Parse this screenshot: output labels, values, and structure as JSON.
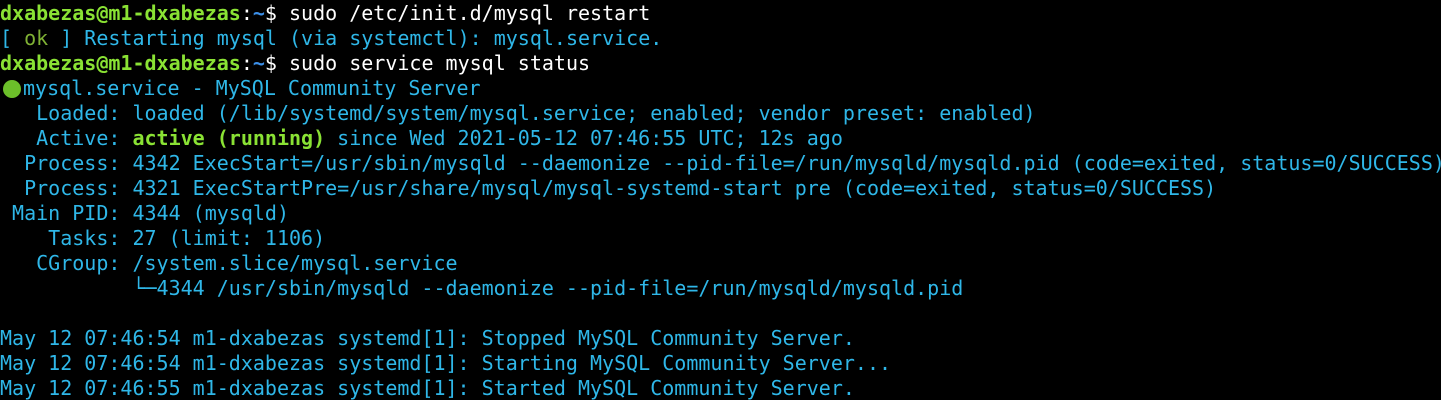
{
  "prompt": {
    "user_host": "dxabezas@m1-dxabezas",
    "separator": ":",
    "path": "~",
    "symbol": "$"
  },
  "commands": [
    "sudo /etc/init.d/mysql restart",
    "sudo service mysql status"
  ],
  "restart_output": {
    "open_bracket": "[ ",
    "ok": "ok",
    "close_bracket": " ] Restarting mysql (via systemctl): mysql.service."
  },
  "status": {
    "unit": "mysql.service - MySQL Community Server",
    "loaded_label": "   Loaded: ",
    "loaded_value": "loaded (/lib/systemd/system/mysql.service; enabled; vendor preset: enabled)",
    "active_label": "   Active: ",
    "active_state": "active (running)",
    "active_since": " since Wed 2021-05-12 07:46:55 UTC; 12s ago",
    "process1": "  Process: 4342 ExecStart=/usr/sbin/mysqld --daemonize --pid-file=/run/mysqld/mysqld.pid (code=exited, status=0/SUCCESS)",
    "process2": "  Process: 4321 ExecStartPre=/usr/share/mysql/mysql-systemd-start pre (code=exited, status=0/SUCCESS)",
    "main_pid": " Main PID: 4344 (mysqld)",
    "tasks": "    Tasks: 27 (limit: 1106)",
    "cgroup": "   CGroup: /system.slice/mysql.service",
    "cgroup_child": "           └─4344 /usr/sbin/mysqld --daemonize --pid-file=/run/mysqld/mysqld.pid"
  },
  "log": [
    "May 12 07:46:54 m1-dxabezas systemd[1]: Stopped MySQL Community Server.",
    "May 12 07:46:54 m1-dxabezas systemd[1]: Starting MySQL Community Server...",
    "May 12 07:46:55 m1-dxabezas systemd[1]: Started MySQL Community Server."
  ],
  "colors": {
    "background": "#000000",
    "prompt_user": "#8ae234",
    "prompt_path": "#3c8fe8",
    "output_text": "#2fb7e8",
    "active_green": "#8ae234",
    "status_dot": "#6cbf2a"
  }
}
